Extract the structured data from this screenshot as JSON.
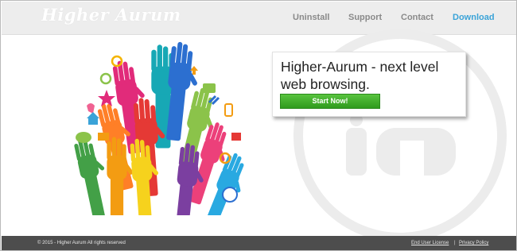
{
  "header": {
    "logo_text": "Higher Aurum",
    "nav": [
      {
        "label": "Uninstall"
      },
      {
        "label": "Support"
      },
      {
        "label": "Contact"
      },
      {
        "label": "Download"
      }
    ],
    "accent_color": "#3aa3d8"
  },
  "hero": {
    "headline": "Higher-Aurum - next level web browsing.",
    "cta_label": "Start Now!",
    "cta_color": "#3fae2a"
  },
  "illustration": {
    "description_icons": [
      "hands-icon",
      "rss-icon",
      "user-icon",
      "bird-icon",
      "link-icon",
      "phone-icon",
      "chat-icon",
      "heart-icon",
      "star-icon",
      "mail-icon",
      "home-icon",
      "share-icon",
      "download-icon",
      "globe-icon",
      "at-icon",
      "gear-icon"
    ]
  },
  "footer": {
    "copyright": "© 2015 - Higher Aurum All rights reserved",
    "links": [
      {
        "label": "End User License"
      },
      {
        "label": "Privacy Policy"
      }
    ],
    "separator": "|"
  }
}
